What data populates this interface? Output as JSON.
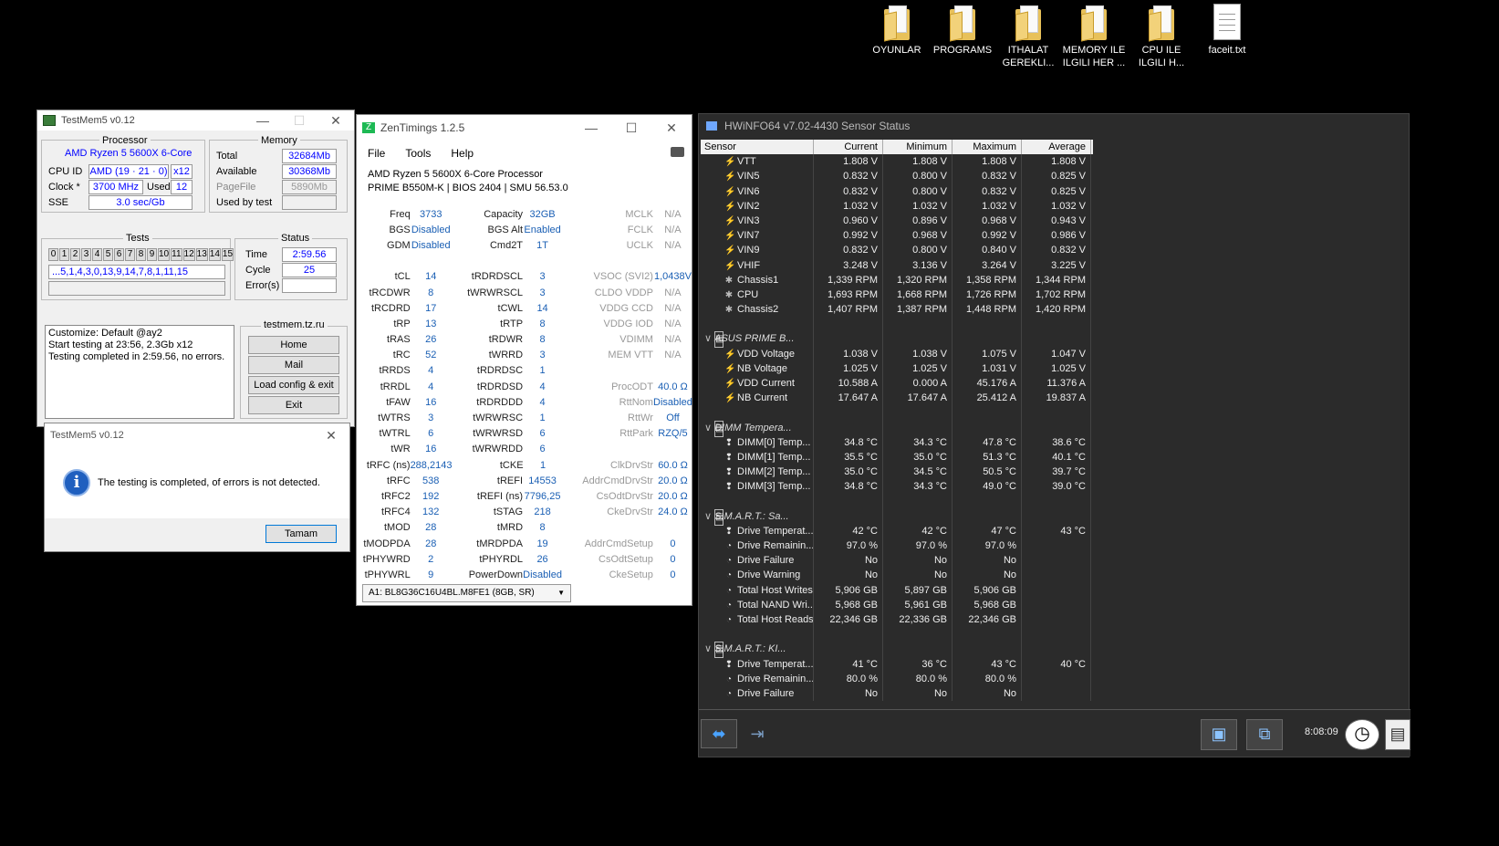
{
  "desktop": {
    "icons": [
      {
        "label": "OYUNLAR",
        "type": "folder"
      },
      {
        "label": "PROGRAMS",
        "type": "folder"
      },
      {
        "label": "ITHALAT GEREKLI...",
        "type": "folder"
      },
      {
        "label": "MEMORY ILE ILGILI HER ...",
        "type": "folder"
      },
      {
        "label": "CPU ILE ILGILI H...",
        "type": "folder"
      },
      {
        "label": "faceit.txt",
        "type": "text-file"
      }
    ]
  },
  "testmem": {
    "title": "TestMem5 v0.12",
    "processor_label": "Processor",
    "processor_name": "AMD Ryzen 5 5600X 6-Core",
    "cpu_id_label": "CPU ID",
    "cpu_id_value": "AMD  (19 · 21 · 0)",
    "cpu_threads": "x12",
    "clock_label": "Clock *",
    "clock_value": "3700 MHz",
    "used_label": "Used",
    "used_value": "12",
    "sse_label": "SSE",
    "sse_value": "3.0 sec/Gb",
    "memory_label": "Memory",
    "total_label": "Total",
    "total_value": "32684Mb",
    "available_label": "Available",
    "available_value": "30368Mb",
    "pagefile_label": "PageFile",
    "pagefile_value": "5890Mb",
    "usedbytest_label": "Used by test",
    "usedbytest_value": "",
    "tests_label": "Tests",
    "test_numbers": [
      "0",
      "1",
      "2",
      "3",
      "4",
      "5",
      "6",
      "7",
      "8",
      "9",
      "10",
      "11",
      "12",
      "13",
      "14",
      "15"
    ],
    "test_sequence": "...5,1,4,3,0,13,9,14,7,8,1,11,15",
    "status_label": "Status",
    "time_label": "Time",
    "time_value": "2:59.56",
    "cycle_label": "Cycle",
    "cycle_value": "25",
    "errors_label": "Error(s)",
    "errors_value": "",
    "log_lines": [
      "Customize: Default @ay2",
      "Start testing at 23:56, 2.3Gb x12",
      "Testing completed in 2:59.56, no errors."
    ],
    "site_label": "testmem.tz.ru",
    "home_button": "Home",
    "mail_button": "Mail",
    "load_button": "Load config & exit",
    "exit_button": "Exit"
  },
  "dialog": {
    "title": "TestMem5 v0.12",
    "message": "The testing is completed, of errors is not detected.",
    "ok_button": "Tamam"
  },
  "zen": {
    "title": "ZenTimings 1.2.5",
    "menu": [
      "File",
      "Tools",
      "Help"
    ],
    "cpu": "AMD Ryzen 5 5600X 6-Core Processor",
    "board": "PRIME B550M-K | BIOS 2404 | SMU 56.53.0",
    "rows": [
      [
        [
          "Freq",
          "3733"
        ],
        [
          "Capacity",
          "32GB"
        ],
        [
          "MCLK",
          "N/A"
        ]
      ],
      [
        [
          "BGS",
          "Disabled"
        ],
        [
          "BGS Alt",
          "Enabled"
        ],
        [
          "FCLK",
          "N/A"
        ]
      ],
      [
        [
          "GDM",
          "Disabled"
        ],
        [
          "Cmd2T",
          "1T"
        ],
        [
          "UCLK",
          "N/A"
        ]
      ],
      [
        [
          "",
          ""
        ],
        [
          "",
          ""
        ],
        [
          "",
          ""
        ]
      ],
      [
        [
          "tCL",
          "14"
        ],
        [
          "tRDRDSCL",
          "3"
        ],
        [
          "VSOC (SVI2)",
          "1,0438V"
        ]
      ],
      [
        [
          "tRCDWR",
          "8"
        ],
        [
          "tWRWRSCL",
          "3"
        ],
        [
          "CLDO VDDP",
          "N/A"
        ]
      ],
      [
        [
          "tRCDRD",
          "17"
        ],
        [
          "tCWL",
          "14"
        ],
        [
          "VDDG CCD",
          "N/A"
        ]
      ],
      [
        [
          "tRP",
          "13"
        ],
        [
          "tRTP",
          "8"
        ],
        [
          "VDDG IOD",
          "N/A"
        ]
      ],
      [
        [
          "tRAS",
          "26"
        ],
        [
          "tRDWR",
          "8"
        ],
        [
          "VDIMM",
          "N/A"
        ]
      ],
      [
        [
          "tRC",
          "52"
        ],
        [
          "tWRRD",
          "3"
        ],
        [
          "MEM VTT",
          "N/A"
        ]
      ],
      [
        [
          "tRRDS",
          "4"
        ],
        [
          "tRDRDSC",
          "1"
        ],
        [
          "",
          ""
        ]
      ],
      [
        [
          "tRRDL",
          "4"
        ],
        [
          "tRDRDSD",
          "4"
        ],
        [
          "ProcODT",
          "40.0 Ω"
        ]
      ],
      [
        [
          "tFAW",
          "16"
        ],
        [
          "tRDRDDD",
          "4"
        ],
        [
          "RttNom",
          "Disabled"
        ]
      ],
      [
        [
          "tWTRS",
          "3"
        ],
        [
          "tWRWRSC",
          "1"
        ],
        [
          "RttWr",
          "Off"
        ]
      ],
      [
        [
          "tWTRL",
          "6"
        ],
        [
          "tWRWRSD",
          "6"
        ],
        [
          "RttPark",
          "RZQ/5"
        ]
      ],
      [
        [
          "tWR",
          "16"
        ],
        [
          "tWRWRDD",
          "6"
        ],
        [
          "",
          ""
        ]
      ],
      [
        [
          "tRFC (ns)",
          "288,2143"
        ],
        [
          "tCKE",
          "1"
        ],
        [
          "ClkDrvStr",
          "60.0 Ω"
        ]
      ],
      [
        [
          "tRFC",
          "538"
        ],
        [
          "tREFI",
          "14553"
        ],
        [
          "AddrCmdDrvStr",
          "20.0 Ω"
        ]
      ],
      [
        [
          "tRFC2",
          "192"
        ],
        [
          "tREFI (ns)",
          "7796,25"
        ],
        [
          "CsOdtDrvStr",
          "20.0 Ω"
        ]
      ],
      [
        [
          "tRFC4",
          "132"
        ],
        [
          "tSTAG",
          "218"
        ],
        [
          "CkeDrvStr",
          "24.0 Ω"
        ]
      ],
      [
        [
          "tMOD",
          "28"
        ],
        [
          "tMRD",
          "8"
        ],
        [
          "",
          ""
        ]
      ],
      [
        [
          "tMODPDA",
          "28"
        ],
        [
          "tMRDPDA",
          "19"
        ],
        [
          "AddrCmdSetup",
          "0"
        ]
      ],
      [
        [
          "tPHYWRD",
          "2"
        ],
        [
          "tPHYRDL",
          "26"
        ],
        [
          "CsOdtSetup",
          "0"
        ]
      ],
      [
        [
          "tPHYWRL",
          "9"
        ],
        [
          "PowerDown",
          "Disabled"
        ],
        [
          "CkeSetup",
          "0"
        ]
      ]
    ],
    "dimm_select": "A1: BL8G36C16U4BL.M8FE1 (8GB, SR)"
  },
  "hwinfo": {
    "title": "HWiNFO64 v7.02-4430 Sensor Status",
    "headers": [
      "Sensor",
      "Current",
      "Minimum",
      "Maximum",
      "Average"
    ],
    "rows": [
      {
        "icon": "bolt",
        "name": "VTT",
        "v": [
          "1.808 V",
          "1.808 V",
          "1.808 V",
          "1.808 V"
        ]
      },
      {
        "icon": "bolt",
        "name": "VIN5",
        "v": [
          "0.832 V",
          "0.800 V",
          "0.832 V",
          "0.825 V"
        ]
      },
      {
        "icon": "bolt",
        "name": "VIN6",
        "v": [
          "0.832 V",
          "0.800 V",
          "0.832 V",
          "0.825 V"
        ]
      },
      {
        "icon": "bolt",
        "name": "VIN2",
        "v": [
          "1.032 V",
          "1.032 V",
          "1.032 V",
          "1.032 V"
        ]
      },
      {
        "icon": "bolt",
        "name": "VIN3",
        "v": [
          "0.960 V",
          "0.896 V",
          "0.968 V",
          "0.943 V"
        ]
      },
      {
        "icon": "bolt",
        "name": "VIN7",
        "v": [
          "0.992 V",
          "0.968 V",
          "0.992 V",
          "0.986 V"
        ]
      },
      {
        "icon": "bolt",
        "name": "VIN9",
        "v": [
          "0.832 V",
          "0.800 V",
          "0.840 V",
          "0.832 V"
        ]
      },
      {
        "icon": "bolt",
        "name": "VHIF",
        "v": [
          "3.248 V",
          "3.136 V",
          "3.264 V",
          "3.225 V"
        ]
      },
      {
        "icon": "fan",
        "name": "Chassis1",
        "v": [
          "1,339 RPM",
          "1,320 RPM",
          "1,358 RPM",
          "1,344 RPM"
        ]
      },
      {
        "icon": "fan",
        "name": "CPU",
        "v": [
          "1,693 RPM",
          "1,668 RPM",
          "1,726 RPM",
          "1,702 RPM"
        ]
      },
      {
        "icon": "fan",
        "name": "Chassis2",
        "v": [
          "1,407 RPM",
          "1,387 RPM",
          "1,448 RPM",
          "1,420 RPM"
        ]
      },
      {
        "icon": "blank",
        "name": "",
        "v": [
          "",
          "",
          "",
          ""
        ]
      },
      {
        "icon": "group",
        "name": "ASUS PRIME B...",
        "v": [
          "",
          "",
          "",
          ""
        ]
      },
      {
        "icon": "bolt",
        "name": "VDD Voltage",
        "v": [
          "1.038 V",
          "1.038 V",
          "1.075 V",
          "1.047 V"
        ]
      },
      {
        "icon": "bolt",
        "name": "NB Voltage",
        "v": [
          "1.025 V",
          "1.025 V",
          "1.031 V",
          "1.025 V"
        ]
      },
      {
        "icon": "bolt",
        "name": "VDD Current",
        "v": [
          "10.588 A",
          "0.000 A",
          "45.176 A",
          "11.376 A"
        ]
      },
      {
        "icon": "bolt",
        "name": "NB Current",
        "v": [
          "17.647 A",
          "17.647 A",
          "25.412 A",
          "19.837 A"
        ]
      },
      {
        "icon": "blank",
        "name": "",
        "v": [
          "",
          "",
          "",
          ""
        ]
      },
      {
        "icon": "group",
        "name": "DIMM Tempera...",
        "v": [
          "",
          "",
          "",
          ""
        ]
      },
      {
        "icon": "therm",
        "name": "DIMM[0] Temp...",
        "v": [
          "34.8 °C",
          "34.3 °C",
          "47.8 °C",
          "38.6 °C"
        ]
      },
      {
        "icon": "therm",
        "name": "DIMM[1] Temp...",
        "v": [
          "35.5 °C",
          "35.0 °C",
          "51.3 °C",
          "40.1 °C"
        ]
      },
      {
        "icon": "therm",
        "name": "DIMM[2] Temp...",
        "v": [
          "35.0 °C",
          "34.5 °C",
          "50.5 °C",
          "39.7 °C"
        ]
      },
      {
        "icon": "therm",
        "name": "DIMM[3] Temp...",
        "v": [
          "34.8 °C",
          "34.3 °C",
          "49.0 °C",
          "39.0 °C"
        ]
      },
      {
        "icon": "blank",
        "name": "",
        "v": [
          "",
          "",
          "",
          ""
        ]
      },
      {
        "icon": "group",
        "name": "S.M.A.R.T.: Sa...",
        "v": [
          "",
          "",
          "",
          ""
        ]
      },
      {
        "icon": "therm",
        "name": "Drive Temperat...",
        "v": [
          "42 °C",
          "42 °C",
          "47 °C",
          "43 °C"
        ]
      },
      {
        "icon": "disk",
        "name": "Drive Remainin...",
        "v": [
          "97.0 %",
          "97.0 %",
          "97.0 %",
          ""
        ]
      },
      {
        "icon": "disk",
        "name": "Drive Failure",
        "v": [
          "No",
          "No",
          "No",
          ""
        ]
      },
      {
        "icon": "disk",
        "name": "Drive Warning",
        "v": [
          "No",
          "No",
          "No",
          ""
        ]
      },
      {
        "icon": "disk",
        "name": "Total Host Writes",
        "v": [
          "5,906 GB",
          "5,897 GB",
          "5,906 GB",
          ""
        ]
      },
      {
        "icon": "disk",
        "name": "Total NAND Wri...",
        "v": [
          "5,968 GB",
          "5,961 GB",
          "5,968 GB",
          ""
        ]
      },
      {
        "icon": "disk",
        "name": "Total Host Reads",
        "v": [
          "22,346 GB",
          "22,336 GB",
          "22,346 GB",
          ""
        ]
      },
      {
        "icon": "blank",
        "name": "",
        "v": [
          "",
          "",
          "",
          ""
        ]
      },
      {
        "icon": "group",
        "name": "S.M.A.R.T.: KI...",
        "v": [
          "",
          "",
          "",
          ""
        ]
      },
      {
        "icon": "therm",
        "name": "Drive Temperat...",
        "v": [
          "41 °C",
          "36 °C",
          "43 °C",
          "40 °C"
        ]
      },
      {
        "icon": "disk",
        "name": "Drive Remainin...",
        "v": [
          "80.0 %",
          "80.0 %",
          "80.0 %",
          ""
        ]
      },
      {
        "icon": "disk",
        "name": "Drive Failure",
        "v": [
          "No",
          "No",
          "No",
          ""
        ]
      }
    ],
    "clock_text": "8:08:09"
  }
}
